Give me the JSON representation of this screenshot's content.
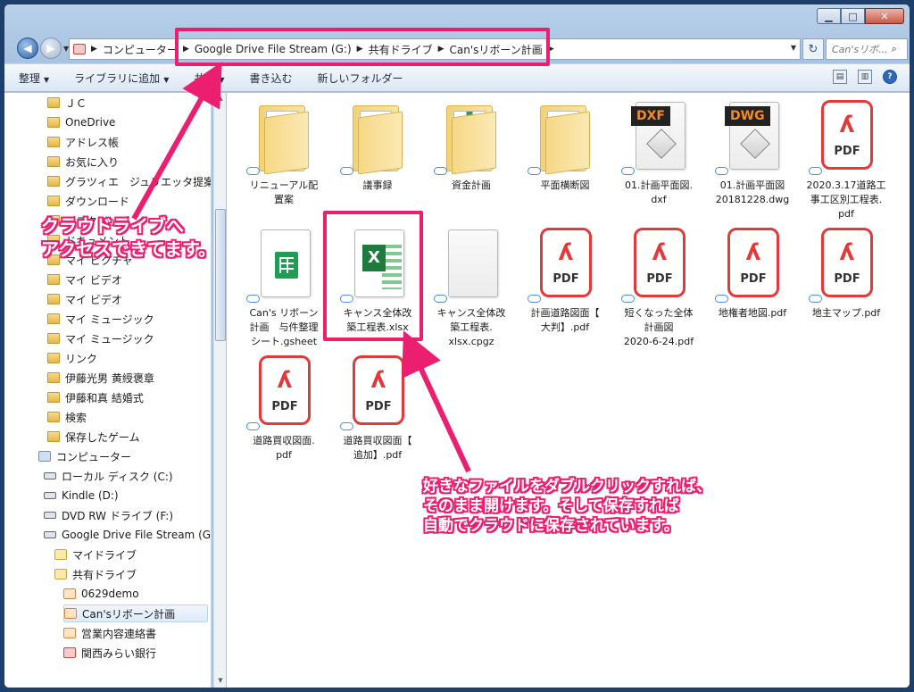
{
  "window": {
    "controls": {
      "minimize": "▁",
      "maximize": "□",
      "close": "✕"
    }
  },
  "nav": {
    "back_icon": "arrow-left-icon",
    "forward_icon": "arrow-right-icon",
    "breadcrumbs": [
      "コンピューター",
      "Google Drive File Stream (G:)",
      "共有ドライブ",
      "Can'sリボーン計画"
    ],
    "search_placeholder": "Can'sリボ..."
  },
  "toolbar": {
    "items": [
      {
        "label": "整理",
        "dropdown": true
      },
      {
        "label": "ライブラリに追加",
        "dropdown": true
      },
      {
        "label": "共有",
        "dropdown": true
      },
      {
        "label": "書き込む",
        "dropdown": false
      },
      {
        "label": "新しいフォルダー",
        "dropdown": false
      }
    ]
  },
  "sidebar": {
    "items": [
      {
        "label": "ＪＣ",
        "type": "folder"
      },
      {
        "label": "OneDrive",
        "type": "folder"
      },
      {
        "label": "アドレス帳",
        "type": "folder"
      },
      {
        "label": "お気に入り",
        "type": "folder"
      },
      {
        "label": "グラツィエ　ジュリエッタ提案",
        "type": "folder"
      },
      {
        "label": "ダウンロード",
        "type": "folder"
      },
      {
        "label": "デスクトップ",
        "type": "folder"
      },
      {
        "label": "ドキュメント",
        "type": "folder"
      },
      {
        "label": "マイ ピクチャ",
        "type": "folder"
      },
      {
        "label": "マイ ビデオ",
        "type": "folder"
      },
      {
        "label": "マイ ビデオ",
        "type": "folder"
      },
      {
        "label": "マイ ミュージック",
        "type": "folder"
      },
      {
        "label": "マイ ミュージック",
        "type": "folder"
      },
      {
        "label": "リンク",
        "type": "folder"
      },
      {
        "label": "伊藤光男 黄綬褒章",
        "type": "folder"
      },
      {
        "label": "伊藤和真 結婚式",
        "type": "folder"
      },
      {
        "label": "検索",
        "type": "folder"
      },
      {
        "label": "保存したゲーム",
        "type": "folder"
      },
      {
        "label": "コンピューター",
        "type": "pc"
      },
      {
        "label": "ローカル ディスク (C:)",
        "type": "drive"
      },
      {
        "label": "Kindle (D:)",
        "type": "drive"
      },
      {
        "label": "DVD RW ドライブ (F:)",
        "type": "drive"
      },
      {
        "label": "Google Drive File Stream (G:)",
        "type": "drive"
      },
      {
        "label": "マイドライブ",
        "type": "gdrive"
      },
      {
        "label": "共有ドライブ",
        "type": "gdrive"
      },
      {
        "label": "0629demo",
        "type": "shared"
      },
      {
        "label": "Can'sリボーン計画",
        "type": "shared",
        "selected": true
      },
      {
        "label": "営業内容連絡書",
        "type": "shared"
      },
      {
        "label": "関西みらい銀行",
        "type": "red"
      }
    ]
  },
  "files": [
    {
      "name": "リニューアル配\n置案",
      "kind": "folder"
    },
    {
      "name": "議事録",
      "kind": "folder"
    },
    {
      "name": "資金計画",
      "kind": "folder-xls"
    },
    {
      "name": "平面横断図",
      "kind": "folder"
    },
    {
      "name": "01.計画平面図.\ndxf",
      "kind": "dxf",
      "badge": "DXF"
    },
    {
      "name": "01.計画平面図\n20181228.dwg",
      "kind": "dwg",
      "badge": "DWG"
    },
    {
      "name": "2020.3.17道路工\n事工区別工程表.\npdf",
      "kind": "pdf"
    },
    {
      "name": "Can's リボーン\n計画　与件整理\nシート.gsheet",
      "kind": "gsheet"
    },
    {
      "name": "キャンス全体改\n築工程表.xlsx",
      "kind": "xlsx"
    },
    {
      "name": "キャンス全体改\n築工程表.\nxlsx.cpgz",
      "kind": "blank"
    },
    {
      "name": "計画道路図面【\n大判】.pdf",
      "kind": "pdf"
    },
    {
      "name": "短くなった全体\n計画図\n2020-6-24.pdf",
      "kind": "pdf"
    },
    {
      "name": "地権者地図.pdf",
      "kind": "pdf"
    },
    {
      "name": "地主マップ.pdf",
      "kind": "pdf"
    },
    {
      "name": "道路買収図面.\npdf",
      "kind": "pdf"
    },
    {
      "name": "道路買収図面【\n追加】.pdf",
      "kind": "pdf"
    }
  ],
  "pdf_label": "PDF",
  "annotations": {
    "callout_top": "クラウドライブへ\nアクセスできてます。",
    "callout_bottom": "好きなファイルをダブルクリックすれば、\nそのまま開けます。そして保存すれば\n自動でクラウドに保存されています。",
    "accent_color": "#ec1e6f"
  },
  "colors": {
    "window_frame": "#a8c4e2",
    "selection": "#dfebfa",
    "pdf_red": "#e23a3a"
  }
}
